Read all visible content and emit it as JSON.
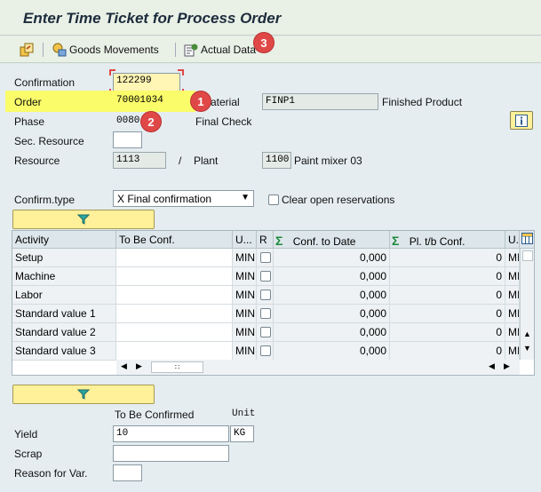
{
  "title": "Enter Time Ticket for Process Order",
  "toolbar": {
    "goods_movements": "Goods Movements",
    "actual_data": "Actual Data"
  },
  "badges": {
    "b1": "1",
    "b2": "2",
    "b3": "3"
  },
  "header": {
    "confirmation_label": "Confirmation",
    "confirmation_value": "122299",
    "order_label": "Order",
    "order_value": "70001034",
    "material_label": "aterial",
    "material_value": "FINP1",
    "material_desc": "Finished Product",
    "phase_label": "Phase",
    "phase_value": "0080",
    "phase_desc": "Final Check",
    "sec_resource_label": "Sec. Resource",
    "sec_resource_value": "",
    "resource_label": "Resource",
    "resource_value": "1113",
    "slash": "/",
    "plant_label": "Plant",
    "plant_value": "1100",
    "plant_desc": "Paint mixer 03"
  },
  "confirm": {
    "type_label": "Confirm.type",
    "type_value": "X Final confirmation",
    "clear_label": "Clear open reservations"
  },
  "grid": {
    "headers": [
      "Activity",
      "To Be Conf.",
      "U...",
      "R",
      "Conf. to Date",
      "Pl. t/b Conf.",
      "U."
    ],
    "rows": [
      {
        "activity": "Setup",
        "to_be": "",
        "unit": "MIN",
        "conf": "0,000",
        "pl": "0",
        "u2": "MI"
      },
      {
        "activity": "Machine",
        "to_be": "",
        "unit": "MIN",
        "conf": "0,000",
        "pl": "0",
        "u2": "MI"
      },
      {
        "activity": "Labor",
        "to_be": "",
        "unit": "MIN",
        "conf": "0,000",
        "pl": "0",
        "u2": "MI"
      },
      {
        "activity": "Standard value 1",
        "to_be": "",
        "unit": "MIN",
        "conf": "0,000",
        "pl": "0",
        "u2": "MI"
      },
      {
        "activity": "Standard value 2",
        "to_be": "",
        "unit": "MIN",
        "conf": "0,000",
        "pl": "0",
        "u2": "MI"
      },
      {
        "activity": "Standard value 3",
        "to_be": "",
        "unit": "MIN",
        "conf": "0,000",
        "pl": "0",
        "u2": "MI"
      }
    ]
  },
  "qty": {
    "to_be_confirmed": "To Be Confirmed",
    "unit_header": "Unit",
    "yield_label": "Yield",
    "yield_value": "10",
    "yield_unit": "KG",
    "scrap_label": "Scrap",
    "scrap_value": "",
    "reason_label": "Reason for Var.",
    "reason_value": ""
  },
  "colors": {
    "accent_yellow": "#fbfc6a",
    "badge": "#e04848",
    "button_yellow": "#fff09a"
  }
}
